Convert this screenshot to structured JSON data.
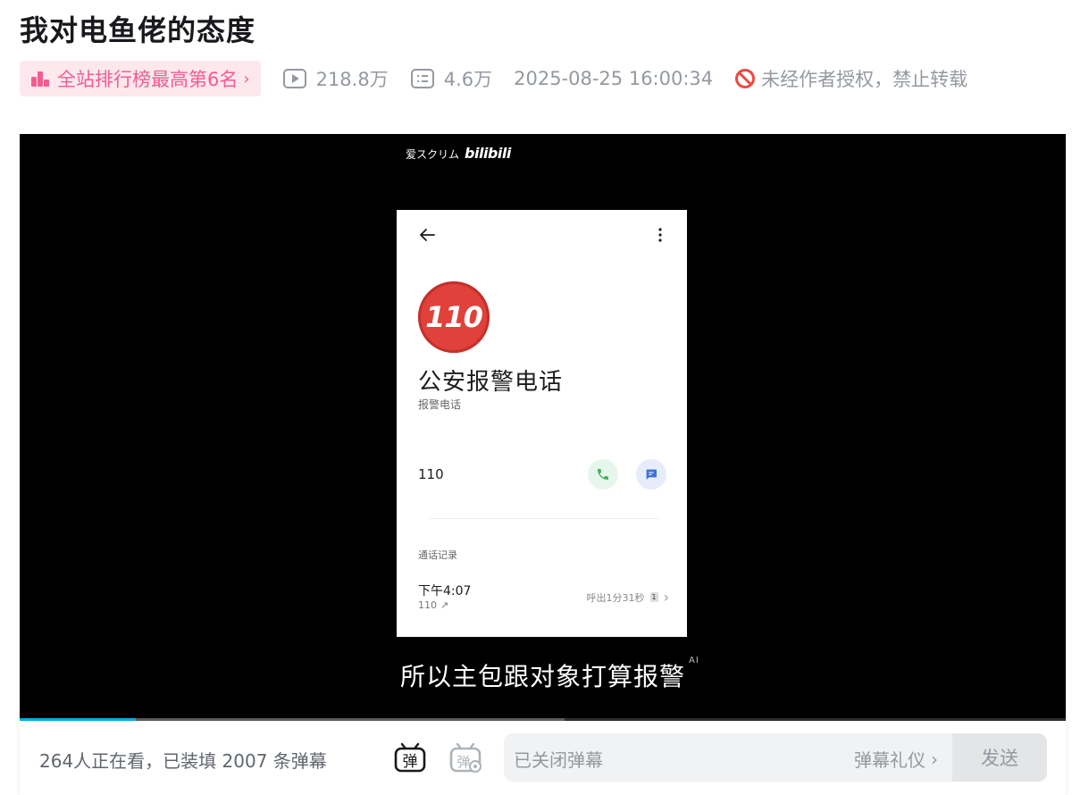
{
  "title": "我对电鱼佬的态度",
  "meta": {
    "rank_label": "全站排行榜最高第6名",
    "views": "218.8万",
    "danmaku_count": "4.6万",
    "publish_time": "2025-08-25 16:00:34",
    "copyright": "未经作者授权，禁止转载"
  },
  "player": {
    "watermark_text": "爱スクリム",
    "watermark_logo": "bilibili",
    "subtitle": "所以主包跟对象打算报警",
    "subtitle_badge": "AI",
    "progress_played": 0.111,
    "progress_buffered": 0.521,
    "phone": {
      "logo_text": "110",
      "contact_name": "公安报警电话",
      "contact_sub": "报警电话",
      "number": "110",
      "records_label": "通话记录",
      "record_time": "下午4:07",
      "record_number": "110",
      "record_duration": "呼出1分31秒",
      "sim_badge": "1"
    }
  },
  "bottom": {
    "viewers": "264人正在看，已装填 2007 条弹幕",
    "input_placeholder": "已关闭弹幕",
    "etiquette_label": "弹幕礼仪",
    "send_label": "发送"
  },
  "colors": {
    "accent_pink": "#f25d8e",
    "badge_bg": "#fde8ee",
    "progress_blue": "#00aeec",
    "muted": "#9499a0"
  }
}
